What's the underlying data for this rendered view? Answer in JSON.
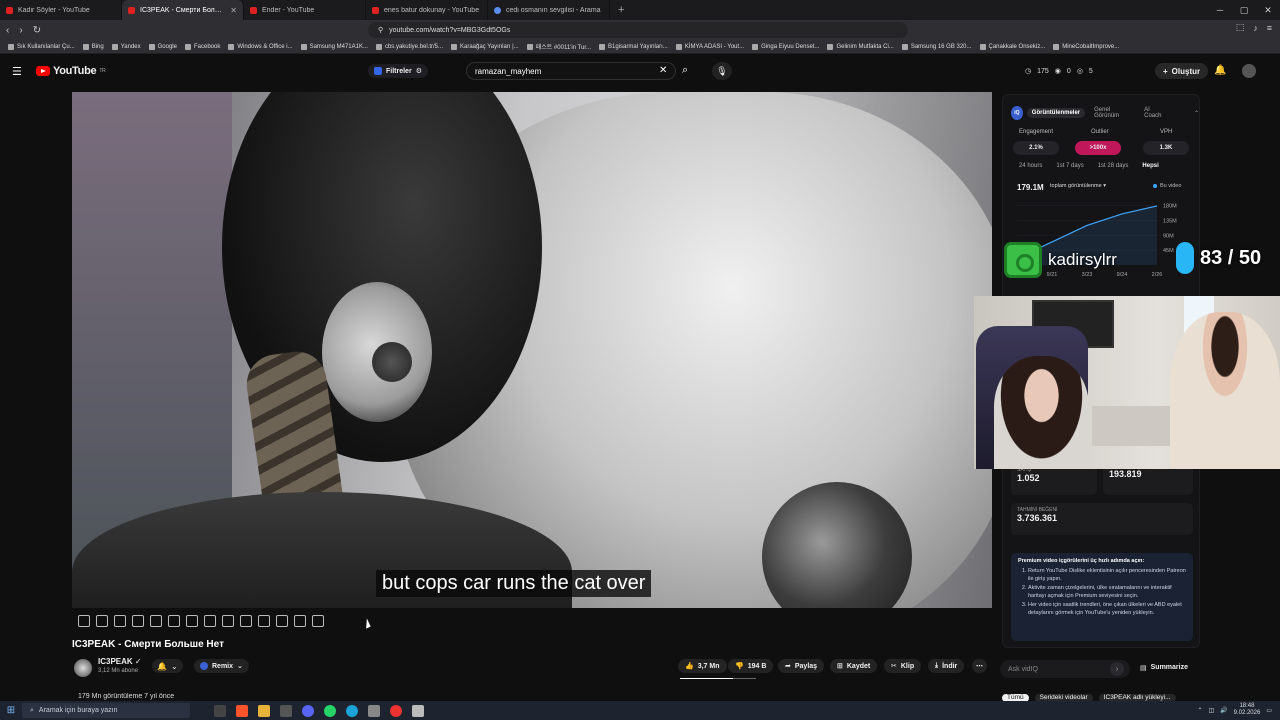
{
  "browser": {
    "tabs": [
      {
        "label": "Kadir Söyler - YouTube",
        "active": false,
        "favicon": "youtube-icon"
      },
      {
        "label": "IC3PEAK - Смерти Больше Нет",
        "active": true,
        "favicon": "youtube-icon"
      },
      {
        "label": "Ender - YouTube",
        "active": false,
        "favicon": "youtube-icon"
      },
      {
        "label": "enes batur dokunay - YouTube",
        "active": false,
        "favicon": "youtube-icon"
      },
      {
        "label": "cedi osmanın sevgilisi - Arama",
        "active": false,
        "favicon": "search-icon"
      }
    ],
    "new_tab": "+",
    "url": "youtube.com/watch?v=MBG3Gdt5OGs",
    "bookmarks": [
      "Sık Kullanılanlar Çu...",
      "Bing",
      "Yandex",
      "Google",
      "Facebook",
      "Windows & Office i...",
      "Samsung M471A1K...",
      "cbs.yakutiye.bel.tr/5...",
      "Karaağaç Yayınları |...",
      "패스트 #0011'in Tur...",
      "B1gisarmal Yayınları...",
      "KİMYA ADASI - Yout...",
      "Ginga Eiyuu Denset...",
      "Gelinim Mutfakta Ci...",
      "Samsung 16 GB 320...",
      "Çanakkale Onsekiz...",
      "MineCobaltImprove..."
    ]
  },
  "youtube": {
    "logo": "YouTube",
    "logo_region": "TR",
    "filters_label": "Filtreler",
    "search_value": "ramazan_mayhem",
    "header_stats": [
      "175",
      "0",
      "5"
    ],
    "create_label": "Oluştur",
    "video": {
      "subtitle": "but cops car runs the cat over",
      "title": "IC3PEAK - Смерти Больше Нет",
      "channel": "IC3PEAK",
      "subscribers": "3,12 Mn abone",
      "remix_label": "Remix",
      "likes": "3,7 Mn",
      "dislikes": "194 B",
      "share": "Paylaş",
      "save": "Kaydet",
      "clip": "Klip",
      "download": "İndir",
      "views_line": "179 Mn görüntüleme  7 yıl önce",
      "like_ratio": 0.7
    },
    "ask_placeholder": "Ask vidIQ",
    "summarize_label": "Summarize",
    "chips": [
      "Tümü",
      "Serideki videolar",
      "IC3PEAK adlı yükleyi..."
    ]
  },
  "panel": {
    "logo": "iQ",
    "tabs": [
      "Görüntülenmeler",
      "Genel Görünüm",
      "AI Coach"
    ],
    "metrics": [
      {
        "label": "Engagement",
        "value": "2.1%"
      },
      {
        "label": "Outlier",
        "value": ">100x"
      },
      {
        "label": "VPH",
        "value": "1.3K"
      }
    ],
    "ranges": [
      "24 hours",
      "1st 7 days",
      "1st 28 days",
      "Hepsi"
    ],
    "total_views": "179.1M",
    "metric_select": "toplam görüntülenme",
    "legend": "Bu video",
    "chart_data": {
      "type": "line",
      "x": [
        "3/20",
        "9/21",
        "3/23",
        "9/24",
        "2/26"
      ],
      "series": [
        {
          "name": "Bu video",
          "values": [
            20,
            70,
            120,
            155,
            179
          ]
        }
      ],
      "yticks": [
        "180M",
        "135M",
        "90M",
        "45M"
      ],
      "ylim": [
        0,
        200
      ],
      "color": "#3ea6ff"
    },
    "cards": [
      {
        "label": "SATIŞ",
        "value": "1.052"
      },
      {
        "label": "",
        "value": "193.819"
      },
      {
        "label": "TAHMİNİ BEĞENİ",
        "value": "3.736.361"
      }
    ],
    "premium": {
      "title": "Premium video içgörülerini üç hızlı adımda açın:",
      "steps": [
        "Return YouTube Dislike eklentisinin açılır penceresinden Patreon ile giriş yapın.",
        "Aktivite zaman çizelgelerini, ülke sıralamalarını ve interaktif haritayı açmak için Premium seviyesini seçin.",
        "Her video için saatlik trendleri, öne çıkan ülkeleri ve ABD eyalet detaylarını görmek için YouTube'u yeniden yükleyin."
      ]
    }
  },
  "overlay": {
    "streamer_name": "kadirsylrr",
    "counter": "83 / 50"
  },
  "taskbar": {
    "search_placeholder": "Aramak için buraya yazın",
    "time": "18:48",
    "date": "9.02.2026"
  },
  "colors": {
    "accent": "#ff0000",
    "outlier": "#c0175b",
    "chart_line": "#3ea6ff"
  }
}
